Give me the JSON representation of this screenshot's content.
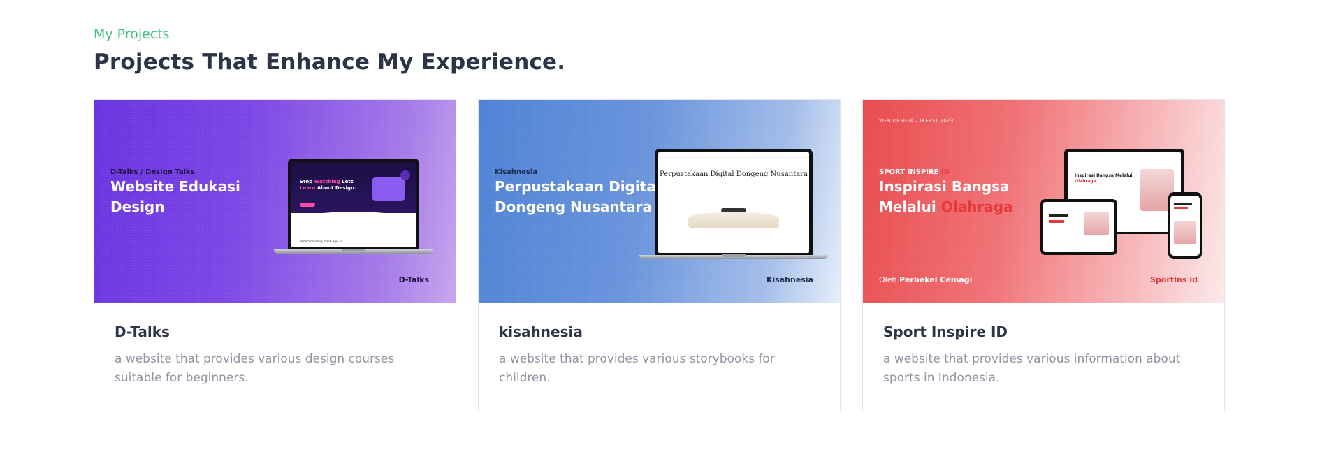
{
  "section": {
    "eyebrow": "My Projects",
    "heading": "Projects That Enhance My Experience."
  },
  "projects": [
    {
      "title": "D-Talks",
      "description": "a website that provides various design courses suitable for beginners.",
      "banner": {
        "kicker": "D-Talks / Design Talks",
        "headline": "Website Edukasi Design",
        "brand": "D-Talks",
        "screen_hero_a": "Stop",
        "screen_hero_accent": "Watching",
        "screen_hero_b": "Lets",
        "screen_hero_c": "Learn",
        "screen_hero_d": "About Design.",
        "screen_footer": "Perfection Using It and Agni.io",
        "gradient_start": "#6a34e0",
        "gradient_end": "#c7a6ee"
      }
    },
    {
      "title": "kisahnesia",
      "description": "a website that provides various storybooks for children.",
      "banner": {
        "kicker": "Kisahnesia",
        "headline": "Perpustakaan Digital Dongeng Nusantara",
        "brand": "Kisahnesia",
        "screen_title": "Perpustakaan Digital Dongeng Nusantara",
        "gradient_start": "#4f82d6",
        "gradient_end": "#e6eef9"
      }
    },
    {
      "title": "Sport Inspire ID",
      "description": "a website that provides various information about sports in Indonesia.",
      "banner": {
        "top_label": "WEB DESIGN – TKFEST 2023",
        "kicker": "SPORT INSPIRE",
        "kicker_accent": "ID",
        "headline_a": "Inspirasi Bangsa Melalui",
        "headline_accent": "Olahraga",
        "by_label": "Oleh",
        "by_name": "Perbekel Cemagi",
        "brand": "SportIns id",
        "screen_hero_a": "Inspirasi Bangsa Melalui",
        "screen_hero_accent": "Olahraga",
        "gradient_start": "#e84b4e",
        "gradient_end": "#fbe9ea",
        "accent": "#e8373a"
      }
    }
  ],
  "colors": {
    "eyebrow": "#3fbf7f",
    "heading": "#2d3447",
    "description": "#8f95a3",
    "card_border": "#e3e5ea"
  }
}
